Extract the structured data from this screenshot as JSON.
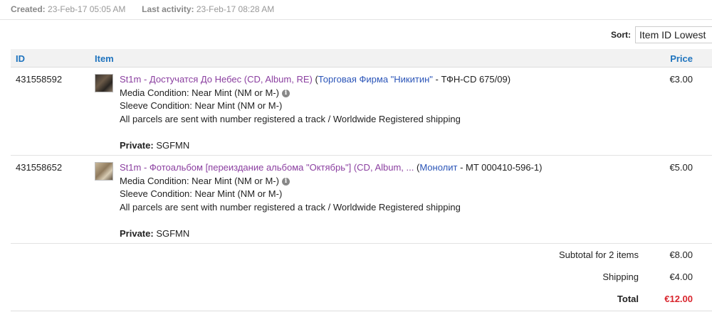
{
  "order_meta": {
    "created_label": "Created:",
    "created_value": "23-Feb-17 05:05 AM",
    "activity_label": "Last activity:",
    "activity_value": "23-Feb-17 08:28 AM"
  },
  "sort": {
    "label": "Sort:",
    "selected": "Item ID Lowest"
  },
  "table": {
    "headers": {
      "id": "ID",
      "item": "Item",
      "price": "Price"
    },
    "rows": [
      {
        "id": "431558592",
        "title": "St1m - Достучатся До Небес (CD, Album, RE)",
        "paren_open": " (",
        "label": "Торговая Фирма \"Никитин\"",
        "catalog": " - ТФН-CD 675/09)",
        "media_condition": "Media Condition: Near Mint (NM or M-)",
        "sleeve_condition": "Sleeve Condition: Near Mint (NM or M-)",
        "shipping_note": "All parcels are sent with number registered a track / Worldwide Registered shipping",
        "private_label": "Private:",
        "private_value": " SGFMN",
        "price": "€3.00"
      },
      {
        "id": "431558652",
        "title": "St1m - Фотоальбом [переиздание альбома \"Октябрь\"] (CD, Album, ...",
        "paren_open": " (",
        "label": "Монолит",
        "catalog": " - MT 000410-596-1)",
        "media_condition": "Media Condition: Near Mint (NM or M-)",
        "sleeve_condition": "Sleeve Condition: Near Mint (NM or M-)",
        "shipping_note": "All parcels are sent with number registered a track / Worldwide Registered shipping",
        "private_label": "Private:",
        "private_value": " SGFMN",
        "price": "€5.00"
      }
    ]
  },
  "summary": {
    "subtotal_label": "Subtotal for 2 items",
    "subtotal_value": "€8.00",
    "shipping_label": "Shipping",
    "shipping_value": "€4.00",
    "total_label": "Total",
    "total_value": "€12.00"
  },
  "colors": {
    "header_link": "#1e73be",
    "item_title": "#8b3fa0",
    "label_link": "#2b55b8",
    "total_red": "#d9262e"
  },
  "icons": [
    "info-icon",
    "release-thumbnail"
  ]
}
